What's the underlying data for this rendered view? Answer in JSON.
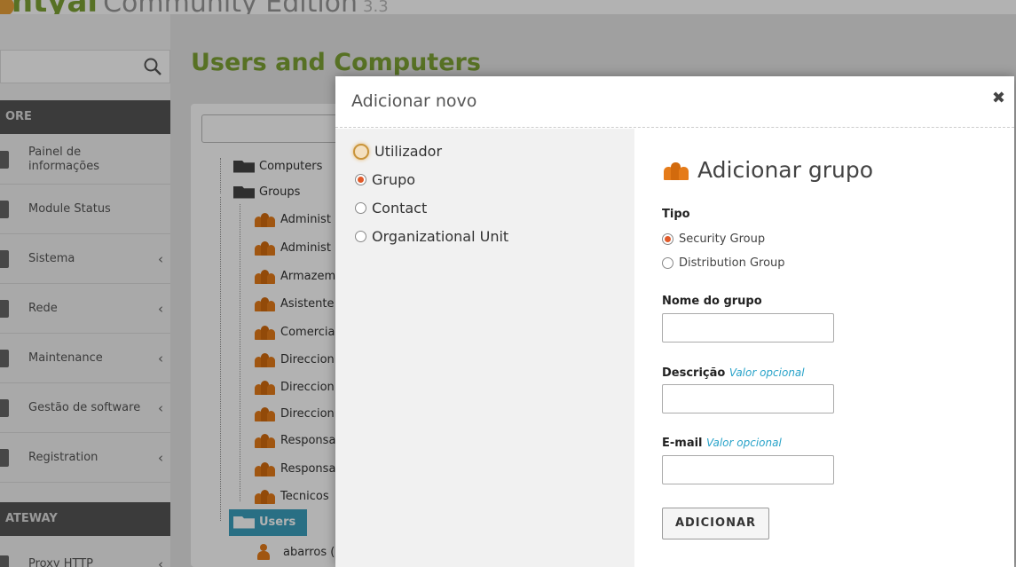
{
  "header": {
    "brand": "zentyal",
    "edition": "Community Edition",
    "version": "3.3"
  },
  "sidebar": {
    "section_core": "ORE",
    "section_gateway": "ATEWAY",
    "items": [
      {
        "label": "Painel de informações",
        "chevron": ""
      },
      {
        "label": "Module Status",
        "chevron": ""
      },
      {
        "label": "Sistema",
        "chevron": "‹"
      },
      {
        "label": "Rede",
        "chevron": "‹"
      },
      {
        "label": "Maintenance",
        "chevron": "‹"
      },
      {
        "label": "Gestão de software",
        "chevron": "‹"
      },
      {
        "label": "Registration",
        "chevron": "‹"
      },
      {
        "label": "Proxy HTTP",
        "chevron": "‹"
      }
    ]
  },
  "page": {
    "title": "Users and Computers"
  },
  "tree": {
    "computers": "Computers",
    "groups": "Groups",
    "group_items": [
      "Administ",
      "Administ",
      "Armazem",
      "Asistente",
      "Comercia",
      "Direccion",
      "Direccion",
      "Direccion",
      "Responsa",
      "Responsa",
      "Tecnicos"
    ],
    "users": "Users",
    "user_items": [
      "abarros ("
    ]
  },
  "modal": {
    "title": "Adicionar novo",
    "close": "✖",
    "options": [
      {
        "label": "Utilizador",
        "checked": false,
        "focused": true
      },
      {
        "label": "Grupo",
        "checked": true,
        "focused": false
      },
      {
        "label": "Contact",
        "checked": false,
        "focused": false
      },
      {
        "label": "Organizational Unit",
        "checked": false,
        "focused": false
      }
    ],
    "form": {
      "heading": "Adicionar grupo",
      "tipo_label": "Tipo",
      "tipo_options": [
        {
          "label": "Security Group",
          "checked": true
        },
        {
          "label": "Distribution Group",
          "checked": false
        }
      ],
      "name_label": "Nome do grupo",
      "name_value": "",
      "desc_label": "Descrição",
      "optional_note": "Valor opcional",
      "desc_value": "",
      "email_label": "E-mail",
      "email_value": "",
      "submit": "ADICIONAR"
    }
  },
  "colors": {
    "brand_green": "#7da234",
    "accent_orange": "#e57b19",
    "selection_blue": "#3b9fbd",
    "optional_blue": "#29a3c9"
  }
}
